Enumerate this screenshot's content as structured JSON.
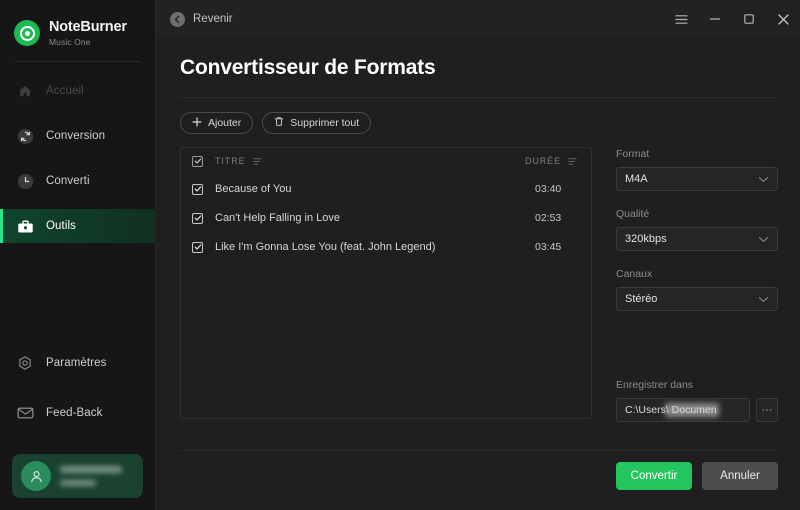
{
  "brand": {
    "name": "NoteBurner",
    "subtitle": "Music One",
    "logo_icon": "noteburner-logo-icon"
  },
  "sidebar": {
    "items": [
      {
        "label": "Accueil",
        "icon": "home-icon",
        "state": "disabled"
      },
      {
        "label": "Conversion",
        "icon": "sync-icon",
        "state": "normal"
      },
      {
        "label": "Converti",
        "icon": "clock-icon",
        "state": "normal"
      },
      {
        "label": "Outils",
        "icon": "toolbox-icon",
        "state": "active"
      }
    ],
    "bottom_items": [
      {
        "label": "Paramètres",
        "icon": "settings-icon"
      },
      {
        "label": "Feed-Back",
        "icon": "mail-icon"
      }
    ],
    "account": {
      "avatar_icon": "user-avatar-icon",
      "name": "",
      "plan": ""
    }
  },
  "titlebar": {
    "back_label": "Revenir",
    "back_icon": "back-arrow-icon",
    "menu_icon": "hamburger-menu-icon",
    "minimize_icon": "minimize-icon",
    "maximize_icon": "maximize-icon",
    "close_icon": "close-icon"
  },
  "page": {
    "title": "Convertisseur de Formats"
  },
  "toolbar": {
    "add_label": "Ajouter",
    "add_icon": "plus-icon",
    "clear_label": "Supprimer tout",
    "clear_icon": "trash-icon"
  },
  "list": {
    "columns": {
      "title": "TITRE",
      "duration": "DURÉE"
    },
    "select_all_checked": true,
    "sort_icon": "sort-icon",
    "tracks": [
      {
        "title": "Because of You",
        "duration": "03:40",
        "checked": true
      },
      {
        "title": "Can't Help Falling in Love",
        "duration": "02:53",
        "checked": true
      },
      {
        "title": "Like I'm Gonna Lose You (feat. John Legend)",
        "duration": "03:45",
        "checked": true
      }
    ]
  },
  "settings": {
    "format": {
      "label": "Format",
      "value": "M4A"
    },
    "quality": {
      "label": "Qualité",
      "value": "320kbps"
    },
    "channels": {
      "label": "Canaux",
      "value": "Stéréo"
    },
    "output": {
      "label": "Enregistrer dans",
      "path": "C:\\Users\\            Documen",
      "browse_label": "···"
    }
  },
  "footer": {
    "convert_label": "Convertir",
    "cancel_label": "Annuler"
  },
  "colors": {
    "accent_green": "#22c55e",
    "brand_green": "#1db954",
    "active_bar": "#2de58a",
    "window_bg": "#1f1f1f",
    "sidebar_bg": "#161616"
  }
}
